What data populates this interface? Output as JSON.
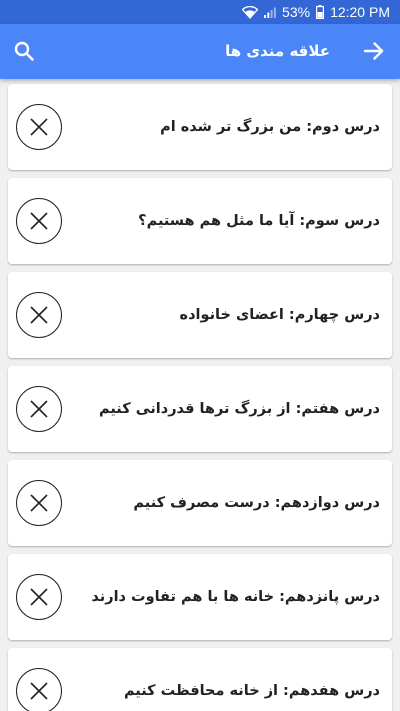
{
  "status_bar": {
    "battery": "53%",
    "time": "12:20 PM"
  },
  "app_bar": {
    "title": "علاقه مندی ها"
  },
  "lessons": [
    {
      "label": "درس دوم: من بزرگ تر شده ام"
    },
    {
      "label": "درس سوم: آیا ما مثل هم هستیم؟"
    },
    {
      "label": "درس چهارم: اعضای خانواده"
    },
    {
      "label": "درس هفتم: از بزرگ ترها قدردانی کنیم"
    },
    {
      "label": "درس دوازدهم: درست مصرف کنیم"
    },
    {
      "label": "درس پانزدهم: خانه ها با هم تفاوت دارند"
    },
    {
      "label": "درس هفدهم: از خانه محافظت کنیم"
    }
  ],
  "colors": {
    "status_bar": "#3367d6",
    "app_bar": "#4a86f7",
    "background": "#f0f0f0"
  },
  "icons": {
    "search": "search-icon",
    "back": "arrow-forward-icon",
    "remove": "close-circle-icon"
  }
}
